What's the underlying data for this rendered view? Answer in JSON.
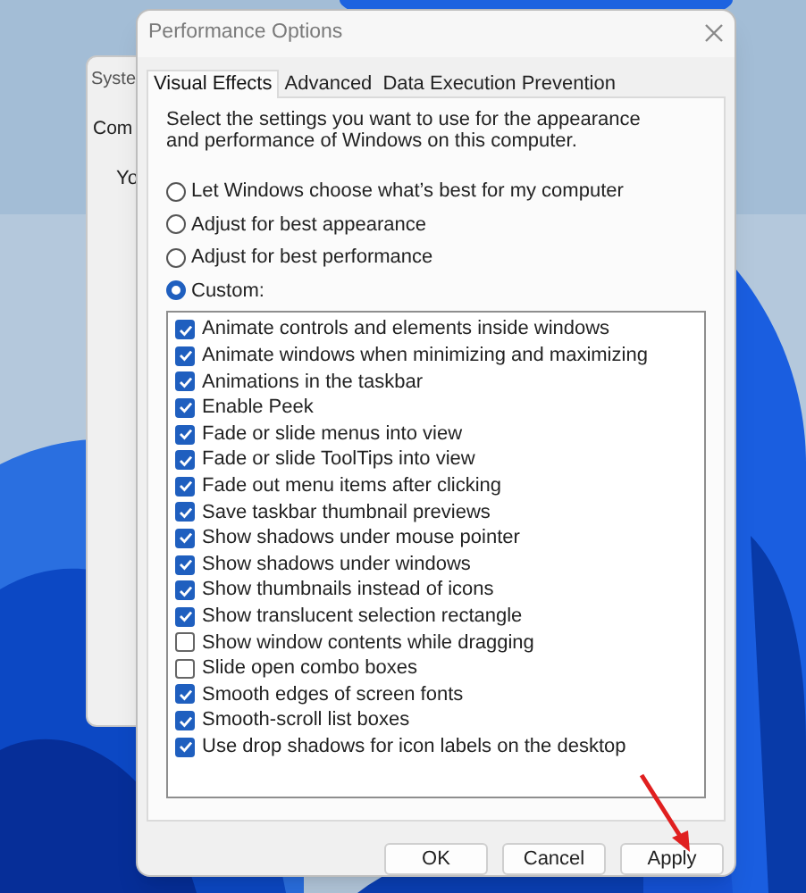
{
  "background_window": {
    "title": "Syste",
    "tab": "Com",
    "label": "Yo"
  },
  "dialog": {
    "title": "Performance Options",
    "tabs": [
      {
        "label": "Visual Effects",
        "selected": true
      },
      {
        "label": "Advanced",
        "selected": false
      },
      {
        "label": "Data Execution Prevention",
        "selected": false
      }
    ],
    "description": "Select the settings you want to use for the appearance and performance of Windows on this computer.",
    "options": [
      {
        "label": "Let Windows choose what’s best for my computer",
        "selected": false
      },
      {
        "label": "Adjust for best appearance",
        "selected": false
      },
      {
        "label": "Adjust for best performance",
        "selected": false
      },
      {
        "label": "Custom:",
        "selected": true
      }
    ],
    "effects": [
      {
        "label": "Animate controls and elements inside windows",
        "checked": true
      },
      {
        "label": "Animate windows when minimizing and maximizing",
        "checked": true
      },
      {
        "label": "Animations in the taskbar",
        "checked": true
      },
      {
        "label": "Enable Peek",
        "checked": true
      },
      {
        "label": "Fade or slide menus into view",
        "checked": true
      },
      {
        "label": "Fade or slide ToolTips into view",
        "checked": true
      },
      {
        "label": "Fade out menu items after clicking",
        "checked": true
      },
      {
        "label": "Save taskbar thumbnail previews",
        "checked": true
      },
      {
        "label": "Show shadows under mouse pointer",
        "checked": true
      },
      {
        "label": "Show shadows under windows",
        "checked": true
      },
      {
        "label": "Show thumbnails instead of icons",
        "checked": true
      },
      {
        "label": "Show translucent selection rectangle",
        "checked": true
      },
      {
        "label": "Show window contents while dragging",
        "checked": false
      },
      {
        "label": "Slide open combo boxes",
        "checked": false
      },
      {
        "label": "Smooth edges of screen fonts",
        "checked": true
      },
      {
        "label": "Smooth-scroll list boxes",
        "checked": true
      },
      {
        "label": "Use drop shadows for icon labels on the desktop",
        "checked": true
      }
    ],
    "buttons": [
      {
        "label": "OK"
      },
      {
        "label": "Cancel"
      },
      {
        "label": "Apply"
      }
    ]
  }
}
